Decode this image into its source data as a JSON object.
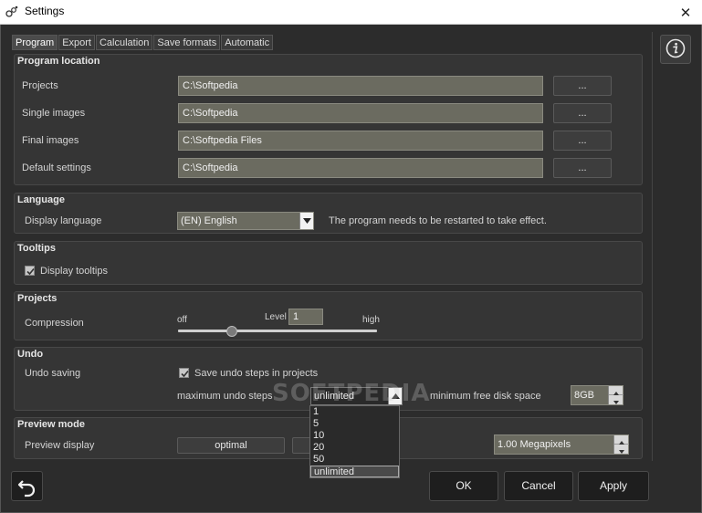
{
  "window": {
    "title": "Settings",
    "close_glyph": "✕"
  },
  "tabs": [
    {
      "label": "Program"
    },
    {
      "label": "Export"
    },
    {
      "label": "Calculation"
    },
    {
      "label": "Save formats"
    },
    {
      "label": "Automatic"
    }
  ],
  "program_location": {
    "title": "Program location",
    "rows": [
      {
        "label": "Projects",
        "value": "C:\\Softpedia",
        "browse": "..."
      },
      {
        "label": "Single images",
        "value": "C:\\Softpedia",
        "browse": "..."
      },
      {
        "label": "Final images",
        "value": "C:\\Softpedia Files",
        "browse": "..."
      },
      {
        "label": "Default settings",
        "value": "C:\\Softpedia",
        "browse": "..."
      }
    ]
  },
  "language": {
    "title": "Language",
    "label": "Display language",
    "value": "(EN) English",
    "note": "The program needs to be restarted to take effect."
  },
  "tooltips": {
    "title": "Tooltips",
    "checkbox_label": "Display tooltips",
    "checked": true
  },
  "projects": {
    "title": "Projects",
    "label": "Compression",
    "min_label": "off",
    "max_label": "high",
    "level_label": "Level",
    "level_value": "1",
    "slider_fraction": 0.27
  },
  "undo": {
    "title": "Undo",
    "label": "Undo saving",
    "checkbox_label": "Save undo steps in projects",
    "checked": true,
    "max_steps_label": "maximum undo steps",
    "max_steps_value": "unlimited",
    "options": [
      "1",
      "5",
      "10",
      "20",
      "50",
      "unlimited"
    ],
    "min_disk_label": "minimum free disk space",
    "min_disk_value": "8GB"
  },
  "preview": {
    "title": "Preview mode",
    "label": "Preview display",
    "mode_button": "optimal",
    "size_value": "1.00 Megapixels"
  },
  "footer": {
    "ok": "OK",
    "cancel": "Cancel",
    "apply": "Apply"
  },
  "watermark": "SOFTPEDIA"
}
